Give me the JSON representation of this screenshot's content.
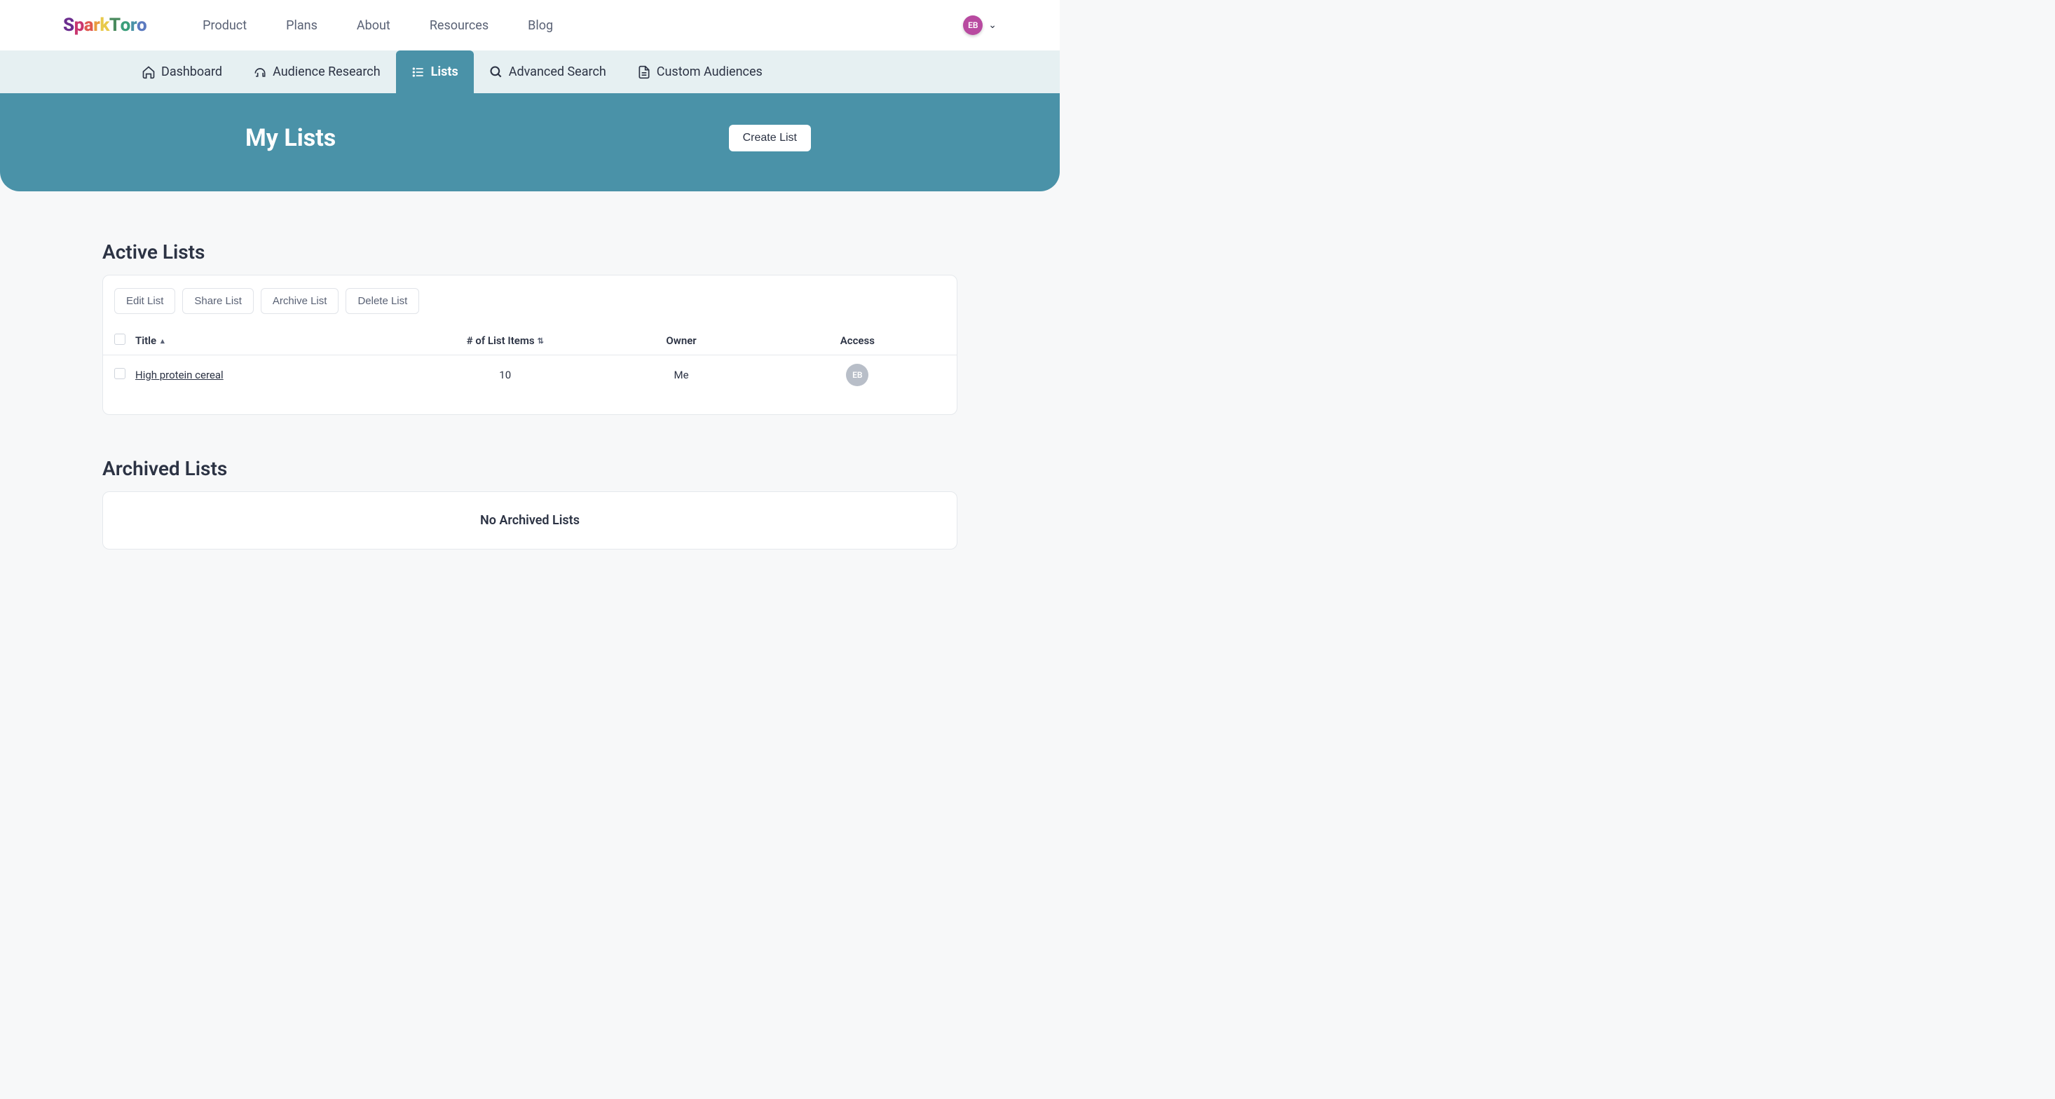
{
  "brand": "SparkToro",
  "nav": {
    "product": "Product",
    "plans": "Plans",
    "about": "About",
    "resources": "Resources",
    "blog": "Blog"
  },
  "user": {
    "initials": "EB"
  },
  "subnav": {
    "dashboard": "Dashboard",
    "audience_research": "Audience Research",
    "lists": "Lists",
    "advanced_search": "Advanced Search",
    "custom_audiences": "Custom Audiences"
  },
  "hero": {
    "title": "My Lists",
    "create_label": "Create List"
  },
  "active_section": {
    "title": "Active Lists",
    "buttons": {
      "edit": "Edit List",
      "share": "Share List",
      "archive": "Archive List",
      "delete": "Delete List"
    },
    "columns": {
      "title": "Title",
      "items": "# of List Items",
      "owner": "Owner",
      "access": "Access"
    },
    "rows": [
      {
        "title": "High protein cereal",
        "items": "10",
        "owner": "Me",
        "access": "EB"
      }
    ]
  },
  "archived_section": {
    "title": "Archived Lists",
    "empty": "No Archived Lists"
  }
}
